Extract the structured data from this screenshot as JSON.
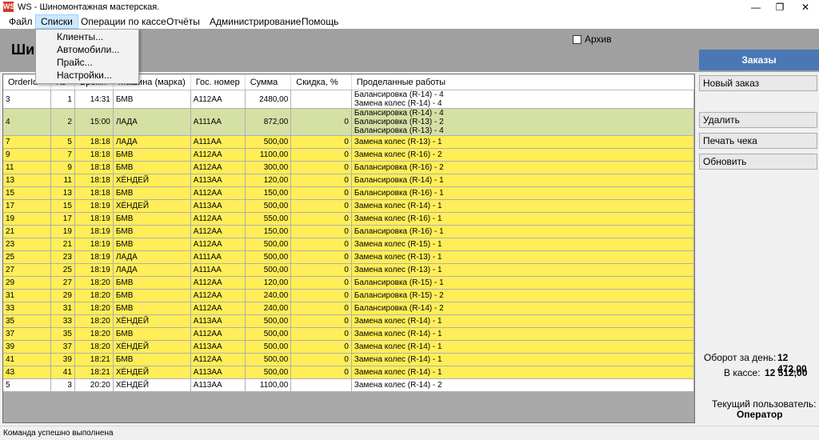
{
  "window": {
    "title": "WS - Шиномонтажная мастерская.",
    "app_icon": "WS"
  },
  "menu": [
    "Файл",
    "Списки",
    "Операции по кассе",
    "Отчёты",
    "Администрирование",
    "Помощь"
  ],
  "dropdown": [
    "Клиенты...",
    "Автомобили...",
    "Прайс...",
    "Настройки..."
  ],
  "header": {
    "title": "Ши",
    "archive_label": "Архив"
  },
  "right_panel": {
    "orders_label": "Заказы",
    "new_order": "Новый заказ",
    "delete": "Удалить",
    "print": "Печать чека",
    "refresh": "Обновить",
    "turnover_label": "Оборот за день:",
    "turnover_value": "12 472,00",
    "cash_label": "В кассе:",
    "cash_value": "12 512,00",
    "user_label": "Текущий пользователь:",
    "user_value": "Оператор"
  },
  "status": "Команда успешно выполнена",
  "columns": [
    "OrderId",
    "№",
    "Время",
    "Машина (марка)",
    "Гос. номер",
    "Сумма",
    "Скидка, %",
    "Проделанные работы"
  ],
  "rows": [
    {
      "style": "white",
      "cells": [
        "3",
        "1",
        "14:31",
        "БМВ",
        "А112АА",
        "2480,00",
        ""
      ],
      "works": [
        "Балансировка (R-14) - 4",
        "Замена колес (R-14) - 4"
      ]
    },
    {
      "style": "green",
      "cells": [
        "4",
        "2",
        "15:00",
        "ЛАДА",
        "А111АА",
        "872,00",
        "0"
      ],
      "works": [
        "Балансировка (R-14) - 4",
        "Балансировка (R-13) - 2",
        "Балансировка (R-13) - 4"
      ]
    },
    {
      "style": "yellow",
      "cells": [
        "7",
        "5",
        "18:18",
        "ЛАДА",
        "А111АА",
        "500,00",
        "0"
      ],
      "works": [
        "Замена колес (R-13) - 1"
      ]
    },
    {
      "style": "yellow",
      "cells": [
        "9",
        "7",
        "18:18",
        "БМВ",
        "А112АА",
        "1100,00",
        "0"
      ],
      "works": [
        "Замена колес (R-16) - 2"
      ]
    },
    {
      "style": "yellow",
      "cells": [
        "11",
        "9",
        "18:18",
        "БМВ",
        "А112АА",
        "300,00",
        "0"
      ],
      "works": [
        "Балансировка (R-16) - 2"
      ]
    },
    {
      "style": "yellow",
      "cells": [
        "13",
        "11",
        "18:18",
        "ХЁНДЕЙ",
        "А113АА",
        "120,00",
        "0"
      ],
      "works": [
        "Балансировка (R-14) - 1"
      ]
    },
    {
      "style": "yellow",
      "cells": [
        "15",
        "13",
        "18:18",
        "БМВ",
        "А112АА",
        "150,00",
        "0"
      ],
      "works": [
        "Балансировка (R-16) - 1"
      ]
    },
    {
      "style": "yellow",
      "cells": [
        "17",
        "15",
        "18:19",
        "ХЁНДЕЙ",
        "А113АА",
        "500,00",
        "0"
      ],
      "works": [
        "Замена колес (R-14) - 1"
      ]
    },
    {
      "style": "yellow",
      "cells": [
        "19",
        "17",
        "18:19",
        "БМВ",
        "А112АА",
        "550,00",
        "0"
      ],
      "works": [
        "Замена колес (R-16) - 1"
      ]
    },
    {
      "style": "yellow",
      "cells": [
        "21",
        "19",
        "18:19",
        "БМВ",
        "А112АА",
        "150,00",
        "0"
      ],
      "works": [
        "Балансировка (R-16) - 1"
      ]
    },
    {
      "style": "yellow",
      "cells": [
        "23",
        "21",
        "18:19",
        "БМВ",
        "А112АА",
        "500,00",
        "0"
      ],
      "works": [
        "Замена колес (R-15) - 1"
      ]
    },
    {
      "style": "yellow",
      "cells": [
        "25",
        "23",
        "18:19",
        "ЛАДА",
        "А111АА",
        "500,00",
        "0"
      ],
      "works": [
        "Замена колес (R-13) - 1"
      ]
    },
    {
      "style": "yellow",
      "cells": [
        "27",
        "25",
        "18:19",
        "ЛАДА",
        "А111АА",
        "500,00",
        "0"
      ],
      "works": [
        "Замена колес (R-13) - 1"
      ]
    },
    {
      "style": "yellow",
      "cells": [
        "29",
        "27",
        "18:20",
        "БМВ",
        "А112АА",
        "120,00",
        "0"
      ],
      "works": [
        "Балансировка (R-15) - 1"
      ]
    },
    {
      "style": "yellow",
      "cells": [
        "31",
        "29",
        "18:20",
        "БМВ",
        "А112АА",
        "240,00",
        "0"
      ],
      "works": [
        "Балансировка (R-15) - 2"
      ]
    },
    {
      "style": "yellow",
      "cells": [
        "33",
        "31",
        "18:20",
        "БМВ",
        "А112АА",
        "240,00",
        "0"
      ],
      "works": [
        "Балансировка (R-14) - 2"
      ]
    },
    {
      "style": "yellow",
      "cells": [
        "35",
        "33",
        "18:20",
        "ХЁНДЕЙ",
        "А113АА",
        "500,00",
        "0"
      ],
      "works": [
        "Замена колес (R-14) - 1"
      ]
    },
    {
      "style": "yellow",
      "cells": [
        "37",
        "35",
        "18:20",
        "БМВ",
        "А112АА",
        "500,00",
        "0"
      ],
      "works": [
        "Замена колес (R-14) - 1"
      ]
    },
    {
      "style": "yellow",
      "cells": [
        "39",
        "37",
        "18:20",
        "ХЁНДЕЙ",
        "А113АА",
        "500,00",
        "0"
      ],
      "works": [
        "Замена колес (R-14) - 1"
      ]
    },
    {
      "style": "yellow",
      "cells": [
        "41",
        "39",
        "18:21",
        "БМВ",
        "А112АА",
        "500,00",
        "0"
      ],
      "works": [
        "Замена колес (R-14) - 1"
      ]
    },
    {
      "style": "yellow",
      "cells": [
        "43",
        "41",
        "18:21",
        "ХЁНДЕЙ",
        "А113АА",
        "500,00",
        "0"
      ],
      "works": [
        "Замена колес (R-14) - 1"
      ]
    },
    {
      "style": "white",
      "cells": [
        "5",
        "3",
        "20:20",
        "ХЁНДЕЙ",
        "А113АА",
        "1100,00",
        ""
      ],
      "works": [
        "Замена колес (R-14) - 2"
      ]
    }
  ]
}
